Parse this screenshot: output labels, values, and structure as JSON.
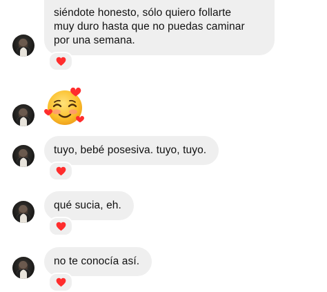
{
  "conversation": {
    "messages": [
      {
        "kind": "text",
        "lines": [
          "siéndote honesto, sólo quiero follarte",
          "muy duro hasta que no puedas caminar",
          "por una semana."
        ],
        "reaction": "red-heart-icon"
      },
      {
        "kind": "emoji",
        "emoji": "smiling-face-with-hearts-icon"
      },
      {
        "kind": "text",
        "lines": [
          "tuyo, bebé posesiva. tuyo, tuyo."
        ],
        "reaction": "red-heart-icon"
      },
      {
        "kind": "text",
        "lines": [
          "qué sucia, eh."
        ],
        "reaction": "red-heart-icon"
      },
      {
        "kind": "text",
        "lines": [
          "no te conocía así."
        ],
        "reaction": "red-heart-icon"
      }
    ]
  },
  "colors": {
    "bubble": "#efefef",
    "text": "#111111",
    "heart": "#ff2d2d",
    "background": "#ffffff"
  }
}
